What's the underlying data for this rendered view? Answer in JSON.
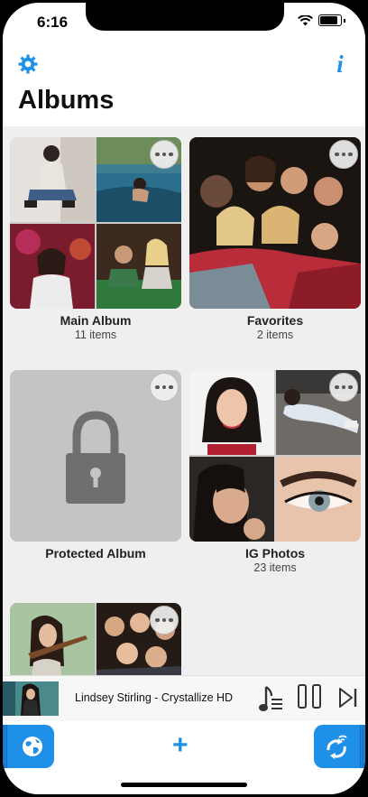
{
  "status_bar": {
    "time": "6:16"
  },
  "nav": {
    "title": "Albums",
    "info_label": "i",
    "settings_icon": "gear-icon"
  },
  "albums": [
    {
      "name": "Main Album",
      "count": "11 items"
    },
    {
      "name": "Favorites",
      "count": "2 items"
    },
    {
      "name": "Protected Album",
      "count": ""
    },
    {
      "name": "IG Photos",
      "count": "23 items"
    }
  ],
  "player": {
    "track": "Lindsey Stirling - Crystallize HD"
  },
  "tab_bar": {
    "add_label": "+"
  },
  "colors": {
    "accent": "#1e90e8",
    "background": "#efefef"
  }
}
